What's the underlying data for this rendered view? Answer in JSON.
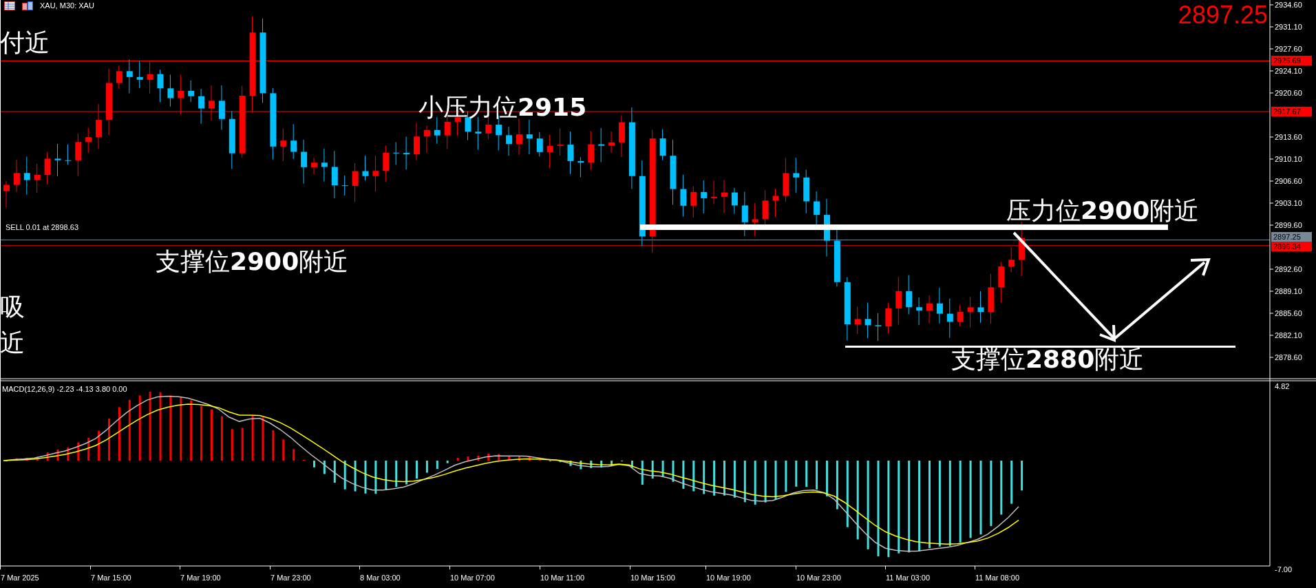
{
  "header": {
    "title": "XAU, M30:  XAU"
  },
  "current_price": "2897.25",
  "order_label": "SELL 0.01 at 2898.63",
  "annotations": [
    {
      "text": "付近"
    },
    {
      "text": "小压力位**2915**"
    },
    {
      "text": "支撑位**2900**附近"
    },
    {
      "text": "吸"
    },
    {
      "text": "近"
    },
    {
      "text": "压力位**2900**附近"
    },
    {
      "text": "支撑位**2880**附近"
    }
  ],
  "price_axis": {
    "ticks": [
      "2934.60",
      "2931.10",
      "2927.60",
      "2924.10",
      "2920.60",
      "2913.60",
      "2910.10",
      "2906.60",
      "2903.10",
      "2899.60",
      "2892.60",
      "2889.10",
      "2885.60",
      "2882.10",
      "2878.60"
    ],
    "markers": [
      {
        "text": "2925.69",
        "color": "#ff0000"
      },
      {
        "text": "2917.67",
        "color": "#ff0000"
      },
      {
        "text": "2897.25",
        "color": "#778899"
      },
      {
        "text": "2896.34",
        "color": "#ff0000"
      }
    ]
  },
  "indicator": {
    "label": "MACD(12,26,9) -2.23 -4.13 3.80 0.00",
    "axis": [
      "4.82",
      "-7.00"
    ]
  },
  "time_axis": [
    "7 Mar 2025",
    "7 Mar 15:00",
    "7 Mar 19:00",
    "7 Mar 23:00",
    "8 Mar 03:00",
    "10 Mar 07:00",
    "10 Mar 11:00",
    "10 Mar 15:00",
    "10 Mar 19:00",
    "10 Mar 23:00",
    "11 Mar 03:00",
    "11 Mar 08:00"
  ]
}
